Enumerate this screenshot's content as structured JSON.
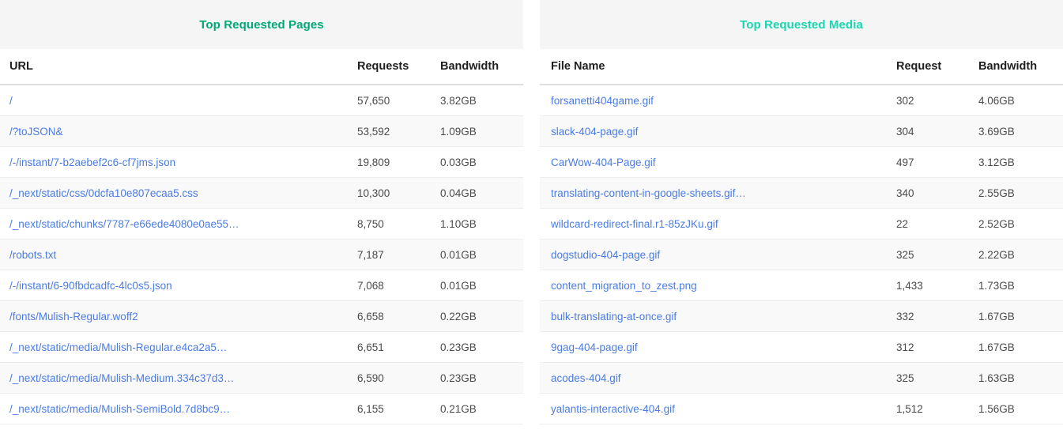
{
  "panels": [
    {
      "title": "Top Requested Pages",
      "title_color": "#00a877",
      "columns": {
        "name": "URL",
        "requests": "Requests",
        "bandwidth": "Bandwidth"
      },
      "rows": [
        {
          "name": "/",
          "requests": "57,650",
          "bandwidth": "3.82GB"
        },
        {
          "name": "/?toJSON&",
          "requests": "53,592",
          "bandwidth": "1.09GB"
        },
        {
          "name": "/-/instant/7-b2aebef2c6-cf7jms.json",
          "requests": "19,809",
          "bandwidth": "0.03GB"
        },
        {
          "name": "/_next/static/css/0dcfa10e807ecaa5.css",
          "requests": "10,300",
          "bandwidth": "0.04GB"
        },
        {
          "name": "/_next/static/chunks/7787-e66ede4080e0ae55…",
          "requests": "8,750",
          "bandwidth": "1.10GB"
        },
        {
          "name": "/robots.txt",
          "requests": "7,187",
          "bandwidth": "0.01GB"
        },
        {
          "name": "/-/instant/6-90fbdcadfc-4lc0s5.json",
          "requests": "7,068",
          "bandwidth": "0.01GB"
        },
        {
          "name": "/fonts/Mulish-Regular.woff2",
          "requests": "6,658",
          "bandwidth": "0.22GB"
        },
        {
          "name": "/_next/static/media/Mulish-Regular.e4ca2a5…",
          "requests": "6,651",
          "bandwidth": "0.23GB"
        },
        {
          "name": "/_next/static/media/Mulish-Medium.334c37d3…",
          "requests": "6,590",
          "bandwidth": "0.23GB"
        },
        {
          "name": "/_next/static/media/Mulish-SemiBold.7d8bc9…",
          "requests": "6,155",
          "bandwidth": "0.21GB"
        }
      ]
    },
    {
      "title": "Top Requested Media",
      "title_color": "#19d6b0",
      "columns": {
        "name": "File Name",
        "requests": "Request",
        "bandwidth": "Bandwidth"
      },
      "rows": [
        {
          "name": "forsanetti404game.gif",
          "requests": "302",
          "bandwidth": "4.06GB"
        },
        {
          "name": "slack-404-page.gif",
          "requests": "304",
          "bandwidth": "3.69GB"
        },
        {
          "name": "CarWow-404-Page.gif",
          "requests": "497",
          "bandwidth": "3.12GB"
        },
        {
          "name": "translating-content-in-google-sheets.gif…",
          "requests": "340",
          "bandwidth": "2.55GB"
        },
        {
          "name": "wildcard-redirect-final.r1-85zJKu.gif",
          "requests": "22",
          "bandwidth": "2.52GB"
        },
        {
          "name": "dogstudio-404-page.gif",
          "requests": "325",
          "bandwidth": "2.22GB"
        },
        {
          "name": "content_migration_to_zest.png",
          "requests": "1,433",
          "bandwidth": "1.73GB"
        },
        {
          "name": "bulk-translating-at-once.gif",
          "requests": "332",
          "bandwidth": "1.67GB"
        },
        {
          "name": "9gag-404-page.gif",
          "requests": "312",
          "bandwidth": "1.67GB"
        },
        {
          "name": "acodes-404.gif",
          "requests": "325",
          "bandwidth": "1.63GB"
        },
        {
          "name": "yalantis-interactive-404.gif",
          "requests": "1,512",
          "bandwidth": "1.56GB"
        }
      ]
    }
  ],
  "colors": {
    "link": "#4a7ce4",
    "header_band": "#f5f5f5",
    "row_stripe": "#f9f9f9",
    "divider": "#ededed"
  }
}
